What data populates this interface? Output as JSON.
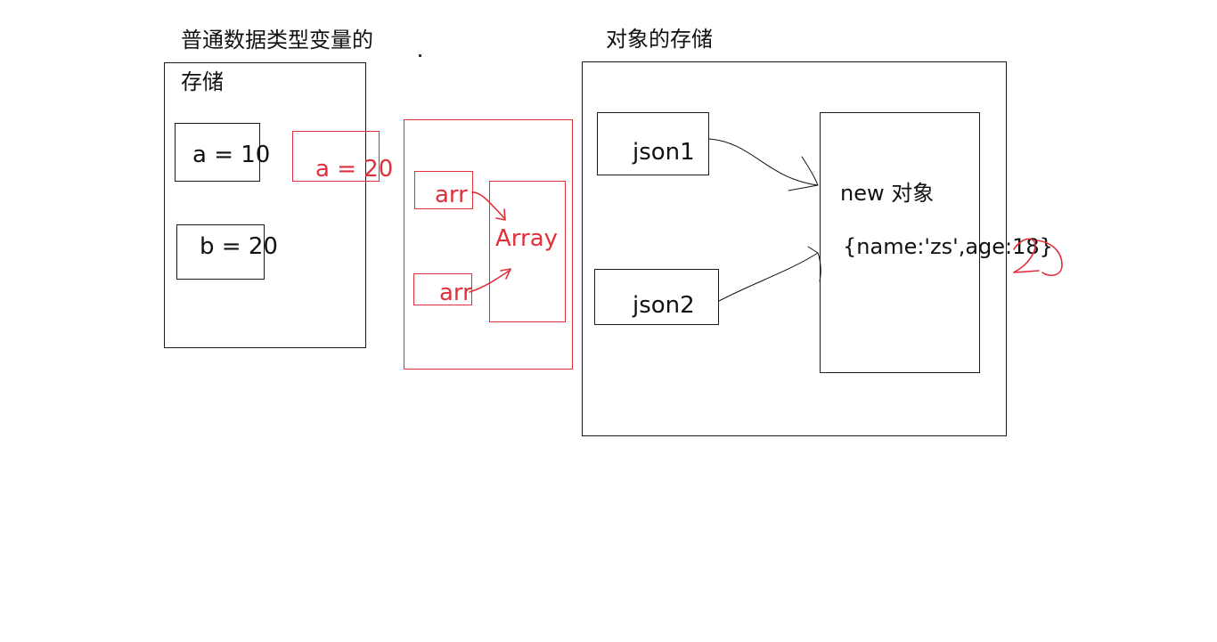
{
  "primitive": {
    "title_line1": "普通数据类型变量的",
    "title_line2": "存储",
    "var_a": "a = 10",
    "var_b": "b = 20",
    "var_a_modified": "a = 20"
  },
  "array_demo": {
    "ref1": "arr",
    "ref2": "arr",
    "target": "Array"
  },
  "object": {
    "title": "对象的存储",
    "ref1": "json1",
    "ref2": "json2",
    "heap_title": "new 对象",
    "heap_content": "{name:'zs',age:18}",
    "annotation_scribble": "2"
  },
  "colors": {
    "ink": "#111111",
    "annotation_red": "#e0303a"
  }
}
